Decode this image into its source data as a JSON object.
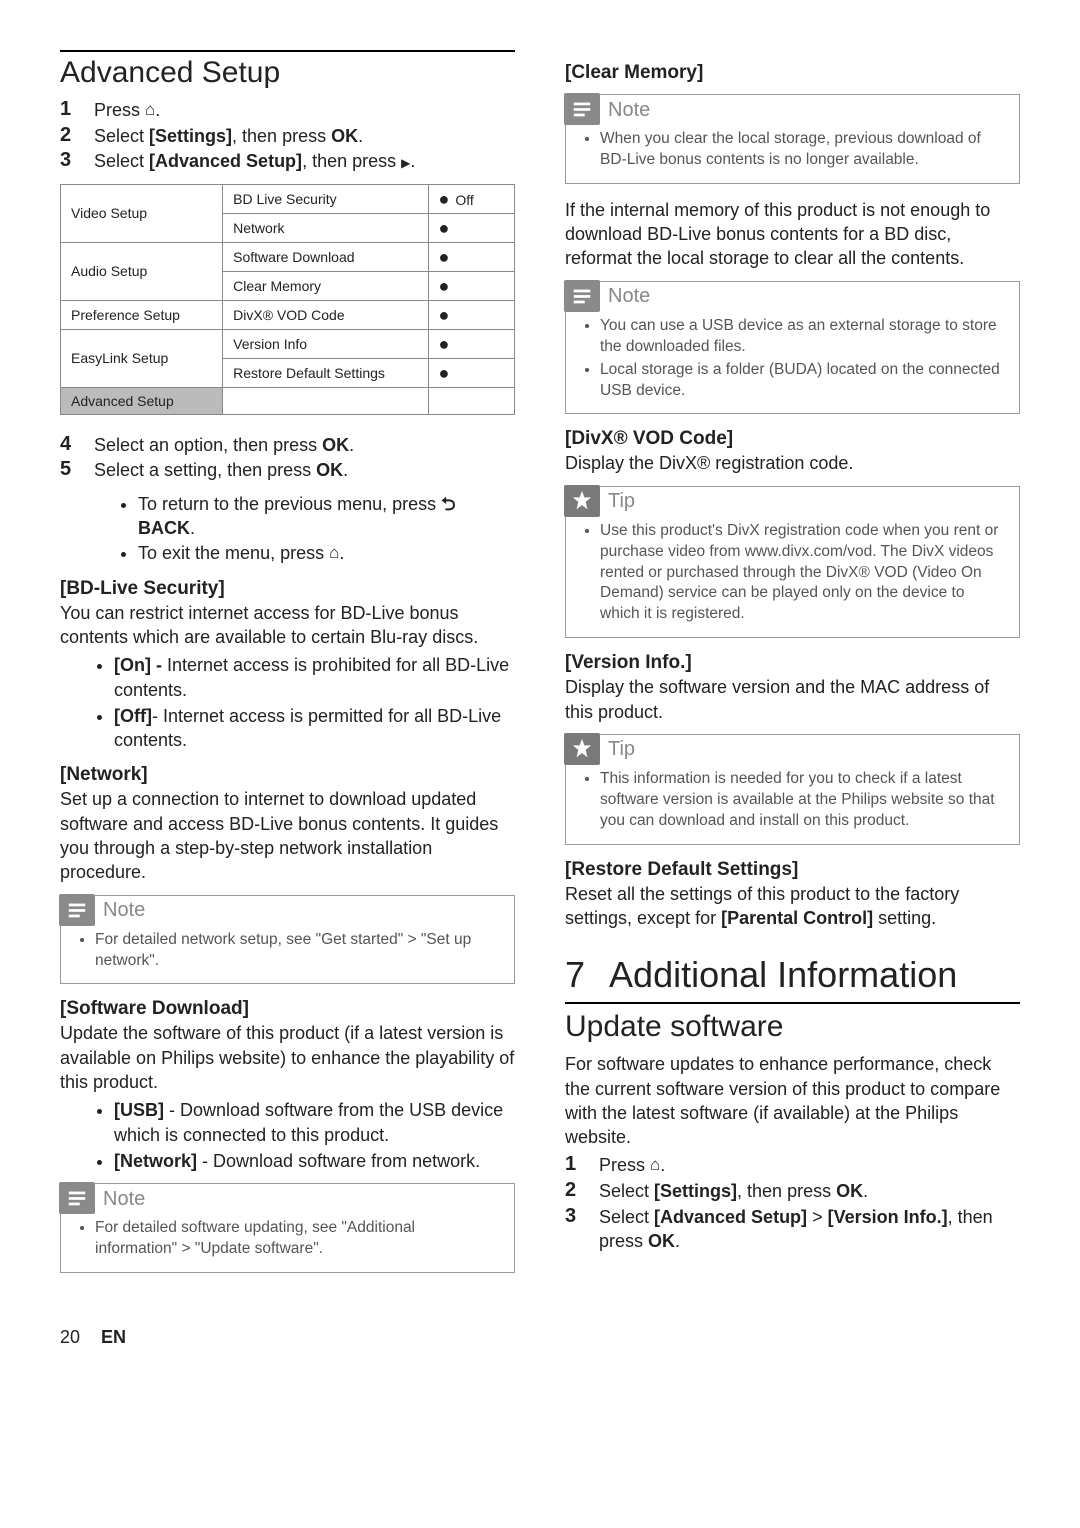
{
  "left": {
    "h1": "Advanced Setup",
    "steps_a": [
      {
        "n": "1",
        "pre": "Press ",
        "icon": "home",
        "post": "."
      },
      {
        "n": "2",
        "pre": "Select ",
        "b": "[Settings]",
        "mid": ", then press ",
        "b2": "OK",
        "post": "."
      },
      {
        "n": "3",
        "pre": "Select ",
        "b": "[Advanced Setup]",
        "mid": ", then press ",
        "icon": "play",
        "post": "."
      }
    ],
    "table": {
      "menu": [
        "Video Setup",
        "Audio Setup",
        "Preference Setup",
        "EasyLink Setup",
        "Advanced Setup"
      ],
      "opts": [
        {
          "label": "BD Live Security",
          "val": "Off"
        },
        {
          "label": "Network",
          "val": ""
        },
        {
          "label": "Software Download",
          "val": ""
        },
        {
          "label": "Clear Memory",
          "val": ""
        },
        {
          "label": "DivX® VOD Code",
          "val": ""
        },
        {
          "label": "Version Info",
          "val": ""
        },
        {
          "label": "Restore Default Settings",
          "val": ""
        }
      ]
    },
    "steps_b": [
      {
        "n": "4",
        "pre": "Select an option, then press ",
        "b": "OK",
        "post": "."
      },
      {
        "n": "5",
        "pre": "Select a setting, then press ",
        "b": "OK",
        "post": "."
      }
    ],
    "steps_b_sub": [
      {
        "pre": "To return to the previous menu, press ",
        "icon": "back",
        "b": " BACK",
        "post": "."
      },
      {
        "pre": "To exit the menu, press ",
        "icon": "home",
        "post": "."
      }
    ],
    "bdlive": {
      "h": "[BD-Live Security]",
      "p": "You can restrict internet access for BD-Live bonus contents which are available to certain Blu-ray discs.",
      "items": [
        {
          "b": "[On] - ",
          "t": "Internet access is prohibited for all BD-Live contents."
        },
        {
          "b": "[Off]",
          "t": "- Internet access is permitted for all BD-Live contents."
        }
      ]
    },
    "network": {
      "h": "[Network]",
      "p": "Set up a connection to internet to download updated software and access BD-Live bonus contents. It guides you through a step-by-step network installation procedure."
    },
    "note1": {
      "label": "Note",
      "items": [
        "For detailed network setup, see \"Get started\" > \"Set up network\"."
      ]
    },
    "swdl": {
      "h": "[Software Download]",
      "p": "Update the software of this product (if a latest version is available on Philips website) to enhance the playability of this product.",
      "items": [
        {
          "b": "[USB]",
          "t": " - Download software from the USB device which is connected to this product."
        },
        {
          "b": "[Network]",
          "t": " - Download software from network."
        }
      ]
    },
    "note2": {
      "label": "Note",
      "items": [
        "For detailed software updating, see \"Additional information\" > \"Update software\"."
      ]
    }
  },
  "right": {
    "clearmem": {
      "h": "[Clear Memory]"
    },
    "note3": {
      "label": "Note",
      "items": [
        "When you clear the local storage, previous download of BD-Live bonus contents is no longer available."
      ]
    },
    "clearmem_p": "If the internal memory of this product is not enough to download BD-Live bonus contents for a BD disc, reformat the local storage to clear all the contents.",
    "note4": {
      "label": "Note",
      "items": [
        "You can use a USB device as an external storage to store the downloaded files.",
        "Local storage is a folder (BUDA) located on the connected USB device."
      ]
    },
    "divx": {
      "h": "[DivX® VOD Code]",
      "p": "Display the DivX® registration code."
    },
    "tip1": {
      "label": "Tip",
      "items": [
        "Use this product's DivX registration code when you rent or purchase video from www.divx.com/vod. The DivX videos rented or purchased through the DivX® VOD (Video On Demand) service can be played only on the device to which it is registered."
      ]
    },
    "version": {
      "h": "[Version Info.]",
      "p": "Display the software version and the MAC address of this product."
    },
    "tip2": {
      "label": "Tip",
      "items": [
        "This information is needed for you to check if a latest software version is available at the Philips website so that you can download and install on this product."
      ]
    },
    "restore": {
      "h": "[Restore Default Settings]",
      "p1": "Reset all the settings of this product to the factory settings, except for ",
      "b": "[Parental Control]",
      "p2": " setting."
    },
    "chapter": {
      "n": "7",
      "t": "Additional Information"
    },
    "update_h": "Update software",
    "update_p": "For software updates to enhance performance, check the current software version of this product to compare with the latest software (if available) at the Philips website.",
    "steps_c": [
      {
        "n": "1",
        "pre": "Press ",
        "icon": "home",
        "post": "."
      },
      {
        "n": "2",
        "pre": "Select ",
        "b": "[Settings]",
        "mid": ", then press ",
        "b2": "OK",
        "post": "."
      },
      {
        "n": "3",
        "pre": "Select ",
        "b": "[Advanced Setup]",
        "mid": " > ",
        "b2": "[Version Info.]",
        "mid2": ", then press ",
        "b3": "OK",
        "post": "."
      }
    ]
  },
  "footer": {
    "page": "20",
    "lang": "EN"
  }
}
